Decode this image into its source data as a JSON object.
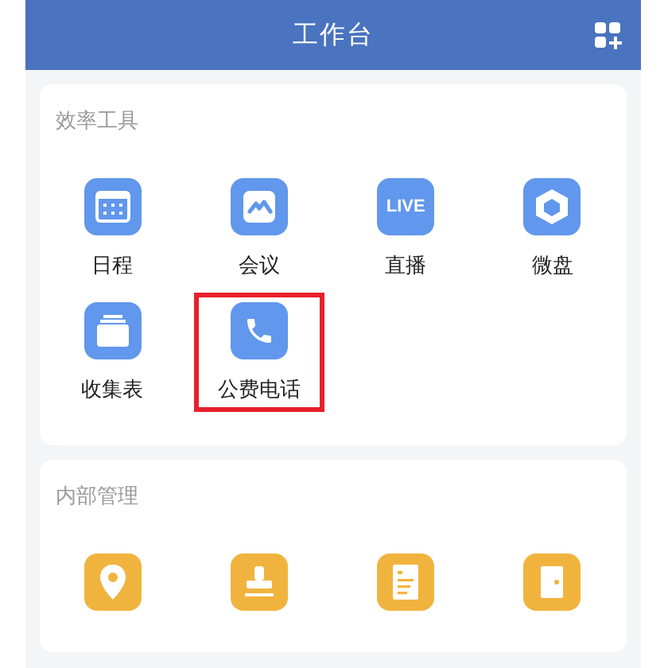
{
  "header": {
    "title": "工作台"
  },
  "sections": [
    {
      "title": "效率工具",
      "color": "#6197ec",
      "items": [
        {
          "label": "日程",
          "kind": "calendar",
          "highlighted": false
        },
        {
          "label": "会议",
          "kind": "meeting",
          "highlighted": false
        },
        {
          "label": "直播",
          "kind": "live",
          "badge_text": "LIVE",
          "highlighted": false
        },
        {
          "label": "微盘",
          "kind": "disk",
          "highlighted": false
        },
        {
          "label": "收集表",
          "kind": "form",
          "highlighted": false
        },
        {
          "label": "公费电话",
          "kind": "phone",
          "highlighted": true
        }
      ]
    },
    {
      "title": "内部管理",
      "color": "#f0b43e",
      "items": [
        {
          "kind": "location",
          "highlighted": false
        },
        {
          "kind": "stamp",
          "highlighted": false
        },
        {
          "kind": "report",
          "highlighted": false
        },
        {
          "kind": "room",
          "highlighted": false
        }
      ]
    }
  ]
}
